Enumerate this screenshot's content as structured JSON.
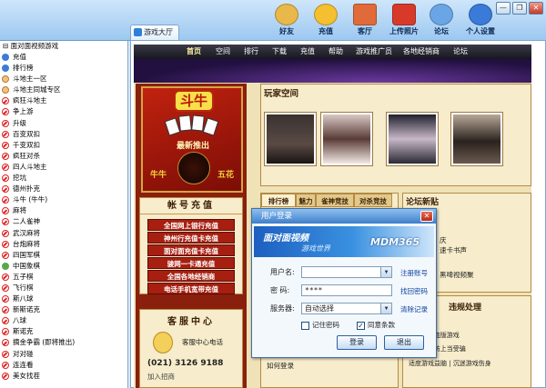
{
  "window": {
    "minimize_glyph": "—",
    "restore_glyph": "❐",
    "close_glyph": "✕"
  },
  "tab": {
    "label": "游戏大厅"
  },
  "toolbar": {
    "items": [
      {
        "label": "好友",
        "icon": "friends-icon",
        "color": "#e8b84a"
      },
      {
        "label": "充值",
        "icon": "coins-icon",
        "color": "#f4c030"
      },
      {
        "label": "客厅",
        "icon": "house-icon",
        "color": "#e06a3a"
      },
      {
        "label": "上传照片",
        "icon": "camera-icon",
        "color": "#d83a2a"
      },
      {
        "label": "论坛",
        "icon": "forum-icon",
        "color": "#6aa6e6"
      },
      {
        "label": "个人设置",
        "icon": "user-settings-icon",
        "color": "#3a7ad8"
      }
    ]
  },
  "sidebar": {
    "root": "面对面视频游戏",
    "items": [
      {
        "label": "充值",
        "icon": "blue"
      },
      {
        "label": "排行榜",
        "icon": "blue"
      },
      {
        "label": "斗地主一区",
        "icon": "face"
      },
      {
        "label": "斗地主同城专区",
        "icon": "face"
      },
      {
        "label": "疯狂斗地主",
        "icon": "ban"
      },
      {
        "label": "争上游",
        "icon": "ban"
      },
      {
        "label": "升级",
        "icon": "ban"
      },
      {
        "label": "百变双扣",
        "icon": "ban"
      },
      {
        "label": "千变双扣",
        "icon": "ban"
      },
      {
        "label": "疯狂对杀",
        "icon": "ban"
      },
      {
        "label": "四人斗地主",
        "icon": "ban"
      },
      {
        "label": "挖坑",
        "icon": "ban"
      },
      {
        "label": "德州扑克",
        "icon": "ban"
      },
      {
        "label": "斗牛 (牛牛)",
        "icon": "ban"
      },
      {
        "label": "麻将",
        "icon": "ban"
      },
      {
        "label": "二人雀神",
        "icon": "ban"
      },
      {
        "label": "武汉麻将",
        "icon": "ban"
      },
      {
        "label": "台炮麻将",
        "icon": "ban"
      },
      {
        "label": "四国军棋",
        "icon": "ban"
      },
      {
        "label": "中国象棋",
        "icon": "green"
      },
      {
        "label": "五子棋",
        "icon": "ban"
      },
      {
        "label": "飞行棋",
        "icon": "ban"
      },
      {
        "label": "斯八球",
        "icon": "ban"
      },
      {
        "label": "新斯诺克",
        "icon": "ban"
      },
      {
        "label": "八球",
        "icon": "ban"
      },
      {
        "label": "斯诺克",
        "icon": "ban"
      },
      {
        "label": "摘金争霸 (即将推出)",
        "icon": "ban"
      },
      {
        "label": "对对碰",
        "icon": "ban"
      },
      {
        "label": "连连看",
        "icon": "ban"
      },
      {
        "label": "美女找茬",
        "icon": "ban"
      }
    ]
  },
  "nav": {
    "items": [
      "首页",
      "空间",
      "排行",
      "下载",
      "充值",
      "帮助",
      "游戏推广员",
      "各地经销商",
      "论坛"
    ]
  },
  "poster": {
    "title": "斗牛",
    "subtitle": "最新推出",
    "left_text": "牛牛",
    "right_text": "五花"
  },
  "recharge": {
    "title": "帐号充值",
    "links": [
      "全国网上银行充值",
      "神州行充值卡充值",
      "面对面充值卡充值",
      "骏网一卡通充值",
      "全国各地经销商",
      "电话手机宽带充值"
    ]
  },
  "service": {
    "title": "客服中心",
    "phone_label": "客服中心电话",
    "phone_number": "(021) 3126 9188",
    "extra": "加入招商"
  },
  "player_space": {
    "title": "玩家空间"
  },
  "rank_tabs": [
    "排行榜",
    "魅力",
    "雀神竞技",
    "对杀竞技"
  ],
  "misc_links": [
    "如何登录"
  ],
  "forum": {
    "title": "论坛新贴",
    "lines": [
      "庆",
      "速卡书声",
      "黑啤视频聚"
    ]
  },
  "violation": {
    "title": "违规处理",
    "lines": [
      "戏 | 拒绝盗版游戏",
      "保护 | 谨防上当受骗",
      "适度游戏益脑 | 沉迷游戏伤身"
    ]
  },
  "login": {
    "title": "用户登录",
    "banner_main": "面对面视频",
    "banner_sub": "游戏世界",
    "banner_brand": "MDM365",
    "username_label": "用户名:",
    "username_value": "",
    "username_link": "注册账号",
    "password_label": "密  码:",
    "password_value": "****",
    "password_link": "找回密码",
    "server_label": "服务器:",
    "server_value": "自动选择",
    "server_link": "清除记录",
    "remember_label": "记住密码",
    "agree_label": "同意条款",
    "agree_mark": "✓",
    "login_button": "登录",
    "exit_button": "退出",
    "close_glyph": "✕"
  }
}
